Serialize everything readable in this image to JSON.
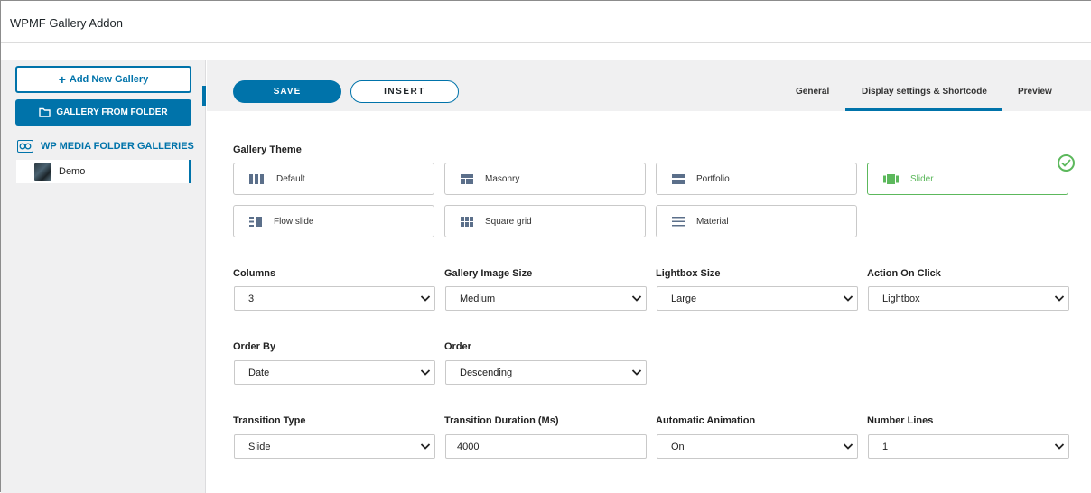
{
  "app": {
    "title": "WPMF Gallery Addon"
  },
  "sidebar": {
    "add_button": "Add New Gallery",
    "folder_button": "GALLERY FROM FOLDER",
    "tree_root": "WP MEDIA FOLDER GALLERIES",
    "items": [
      {
        "label": "Demo"
      }
    ]
  },
  "toolbar": {
    "save_label": "SAVE",
    "insert_label": "INSERT",
    "tabs": [
      {
        "label": "General",
        "active": false
      },
      {
        "label": "Display settings & Shortcode",
        "active": true
      },
      {
        "label": "Preview",
        "active": false
      }
    ]
  },
  "gallery_theme": {
    "label": "Gallery Theme",
    "selected": "Slider",
    "options": [
      {
        "label": "Default",
        "icon": "default-layout-icon"
      },
      {
        "label": "Masonry",
        "icon": "masonry-layout-icon"
      },
      {
        "label": "Portfolio",
        "icon": "portfolio-layout-icon"
      },
      {
        "label": "Slider",
        "icon": "slider-layout-icon"
      },
      {
        "label": "Flow slide",
        "icon": "flow-slide-layout-icon"
      },
      {
        "label": "Square grid",
        "icon": "square-grid-layout-icon"
      },
      {
        "label": "Material",
        "icon": "material-layout-icon"
      }
    ]
  },
  "settings": {
    "columns": {
      "label": "Columns",
      "value": "3"
    },
    "image_size": {
      "label": "Gallery Image Size",
      "value": "Medium"
    },
    "lightbox_size": {
      "label": "Lightbox Size",
      "value": "Large"
    },
    "action_on_click": {
      "label": "Action On Click",
      "value": "Lightbox"
    },
    "order_by": {
      "label": "Order By",
      "value": "Date"
    },
    "order": {
      "label": "Order",
      "value": "Descending"
    },
    "transition_type": {
      "label": "Transition Type",
      "value": "Slide"
    },
    "transition_duration": {
      "label": "Transition Duration (Ms)",
      "value": "4000"
    },
    "automatic_animation": {
      "label": "Automatic Animation",
      "value": "On"
    },
    "number_lines": {
      "label": "Number Lines",
      "value": "1"
    }
  },
  "colors": {
    "accent": "#0073aa",
    "selected": "#5cb85c",
    "panel_bg": "#f0f0f1"
  }
}
